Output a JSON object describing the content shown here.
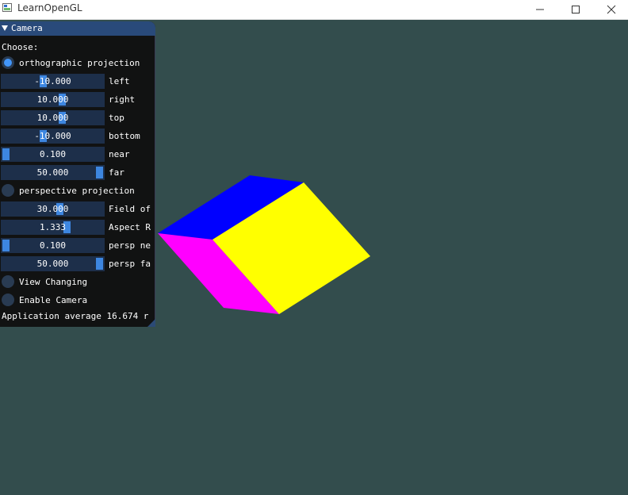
{
  "window": {
    "title": "LearnOpenGL",
    "icon": "app-window-icon",
    "controls": [
      "minimize-icon",
      "maximize-icon",
      "close-icon"
    ]
  },
  "panel": {
    "title": "Camera",
    "choose_label": "Choose:",
    "ortho": {
      "label": "orthographic projection",
      "selected": true,
      "sliders": [
        {
          "value": "-10.000",
          "label": "left",
          "fraction": 0.4
        },
        {
          "value": "10.000",
          "label": "right",
          "fraction": 0.6
        },
        {
          "value": "10.000",
          "label": "top",
          "fraction": 0.6
        },
        {
          "value": "-10.000",
          "label": "bottom",
          "fraction": 0.4
        },
        {
          "value": "0.100",
          "label": "near",
          "fraction": 0.0
        },
        {
          "value": "50.000",
          "label": "far",
          "fraction": 1.0
        }
      ]
    },
    "persp": {
      "label": "perspective projection",
      "selected": false,
      "sliders": [
        {
          "value": "30.000",
          "label": "Field of",
          "fraction": 0.58
        },
        {
          "value": "1.333",
          "label": "Aspect R",
          "fraction": 0.65
        },
        {
          "value": "0.100",
          "label": "persp ne",
          "fraction": 0.0
        },
        {
          "value": "50.000",
          "label": "persp fa",
          "fraction": 1.0
        }
      ]
    },
    "view_changing": {
      "label": "View Changing",
      "checked": false
    },
    "enable_camera": {
      "label": "Enable Camera",
      "checked": false
    },
    "footer": "Application average 16.674 r"
  },
  "colors": {
    "background": "#334d4d",
    "accent": "#4296fa",
    "cube_top": "#0000ff",
    "cube_left": "#ff00ff",
    "cube_right": "#ffff00"
  }
}
